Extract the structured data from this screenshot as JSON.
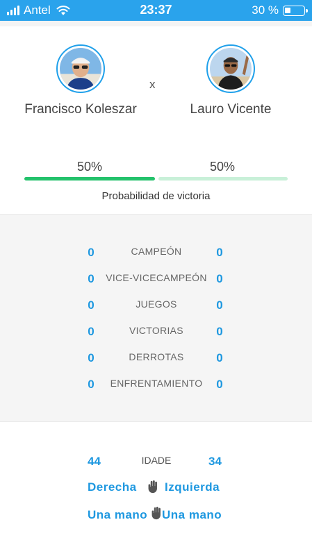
{
  "status_bar": {
    "carrier": "Antel",
    "time": "23:37",
    "battery": "30 %",
    "battery_level": 0.3,
    "bg_color": "#2aa3ec"
  },
  "players": [
    {
      "name": "Francisco Koleszar",
      "avatar_icon": "player-photo"
    },
    {
      "name": "Lauro Vicente",
      "avatar_icon": "player-photo"
    }
  ],
  "vs_label": "x",
  "probability": {
    "player1": "50%",
    "player2": "50%",
    "player1_fraction": 0.5,
    "label": "Probabilidad de victoria",
    "color_p1": "#23c26b",
    "color_p2": "#c8f0d8"
  },
  "stats": [
    {
      "label": "CAMPEÓN",
      "p1": "0",
      "p2": "0"
    },
    {
      "label": "VICE-VICECAMPEÓN",
      "p1": "0",
      "p2": "0"
    },
    {
      "label": "JUEGOS",
      "p1": "0",
      "p2": "0"
    },
    {
      "label": "VICTORIAS",
      "p1": "0",
      "p2": "0"
    },
    {
      "label": "DERROTAS",
      "p1": "0",
      "p2": "0"
    },
    {
      "label": "ENFRENTAMIENTO",
      "p1": "0",
      "p2": "0"
    }
  ],
  "profile": {
    "age_label": "IDADE",
    "age_p1": "44",
    "age_p2": "34",
    "hand_p1": "Derecha",
    "hand_p2": "Izquierda",
    "hand_icon": "hand-icon",
    "backhand_p1": "Una mano",
    "backhand_p2": "Una mano",
    "backhand_icon": "hand-icon"
  },
  "accent_color": "#1e98e0"
}
